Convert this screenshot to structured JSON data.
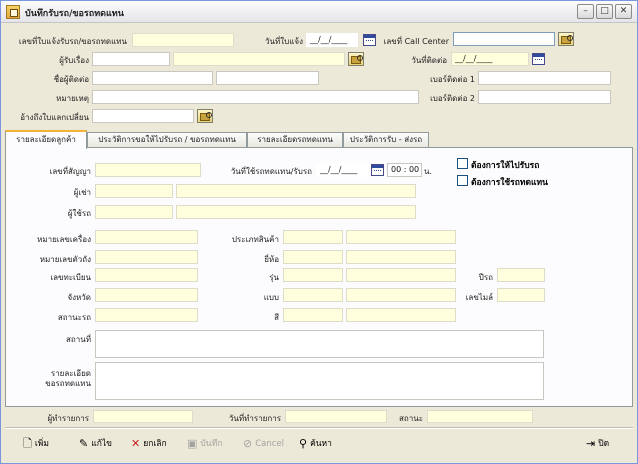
{
  "window": {
    "title": "บันทึกรับรถ/ขอรถทดแทน",
    "minimize_glyph": "–",
    "maximize_glyph": "□",
    "close_glyph": "✕"
  },
  "header": {
    "doc_no_label": "เลขที่ใบแจ้งรับรถ/ขอรถทดแทน",
    "doc_no_value": "",
    "notify_date_label": "วันที่ใบแจ้ง",
    "notify_date_value": "__/__/____",
    "call_center_label": "เลขที่ Call Center",
    "call_center_value": "",
    "receiver_label": "ผู้รับเรื่อง",
    "receiver_code": "",
    "receiver_name": "",
    "contact_date_label": "วันที่ติดต่อ",
    "contact_date_value": "__/__/____",
    "contact_name_label": "ชื่อผู้ติดต่อ",
    "contact_first": "",
    "contact_last": "",
    "phone1_label": "เบอร์ติดต่อ 1",
    "phone1_value": "",
    "remark_label": "หมายเหตุ",
    "remark_value": "",
    "phone2_label": "เบอร์ติดต่อ 2",
    "phone2_value": "",
    "ref_exchange_label": "อ้างถึงใบแลกเปลี่ยน",
    "ref_exchange_value": ""
  },
  "tabs": [
    {
      "label": "รายละเอียดลูกค้า",
      "active": true
    },
    {
      "label": "ประวัติการขอให้ไปรับรถ / ขอรถทดแทน",
      "active": false
    },
    {
      "label": "รายละเอียดรถทดแทน",
      "active": false
    },
    {
      "label": "ประวัติการรับ - ส่งรถ",
      "active": false
    }
  ],
  "customer": {
    "contract_no_label": "เลขที่สัญญา",
    "contract_no_value": "",
    "use_date_label": "วันที่ใช้รถทดแทน/รับรถ",
    "use_date_value": "__/__/____",
    "time_hour": "00",
    "time_min": "00",
    "time_unit": "น.",
    "chk_pickup_label": "ต้องการให้ไปรับรถ",
    "chk_replace_label": "ต้องการใช้รถทดแทน",
    "renter_label": "ผู้เช่า",
    "renter_code": "",
    "renter_name": "",
    "user_label": "ผู้ใช้รถ",
    "user_code": "",
    "user_name": "",
    "engine_no_label": "หมายเลขเครื่อง",
    "engine_no_value": "",
    "product_type_label": "ประเภทสินค้า",
    "product_type_code": "",
    "product_type_name": "",
    "chassis_no_label": "หมายเลขตัวถัง",
    "chassis_no_value": "",
    "brand_label": "ยี่ห้อ",
    "brand_code": "",
    "brand_name": "",
    "plate_label": "เลขทะเบียน",
    "plate_value": "",
    "model_label": "รุ่น",
    "model_code": "",
    "model_name": "",
    "year_label": "ปีรถ",
    "year_value": "",
    "province_label": "จังหวัด",
    "province_value": "",
    "style_label": "แบบ",
    "style_code": "",
    "style_name": "",
    "mileage_label": "เลขไมล์",
    "mileage_value": "",
    "car_status_label": "สถานะรถ",
    "car_status_value": "",
    "color_label": "สี",
    "color_code": "",
    "color_name": "",
    "location_label": "สถานที่",
    "location_value": "",
    "replace_detail_label_1": "รายละเอียด",
    "replace_detail_label_2": "ขอรถทดแทน",
    "replace_detail_value": ""
  },
  "status": {
    "operator_label": "ผู้ทำรายการ",
    "operator_value": "",
    "op_date_label": "วันที่ทำรายการ",
    "op_date_value": "",
    "state_label": "สถานะ",
    "state_value": ""
  },
  "toolbar": {
    "add": "เพิ่ม",
    "edit": "แก้ไข",
    "cancel_doc": "ยกเลิก",
    "save": "บันทึก",
    "cancel": "Cancel",
    "search": "ค้นหา",
    "close": "ปิด"
  },
  "colors": {
    "yellow_field": "#ffffdd",
    "form_bg": "#ece9d8",
    "active_tab_accent": "#f2b137"
  }
}
